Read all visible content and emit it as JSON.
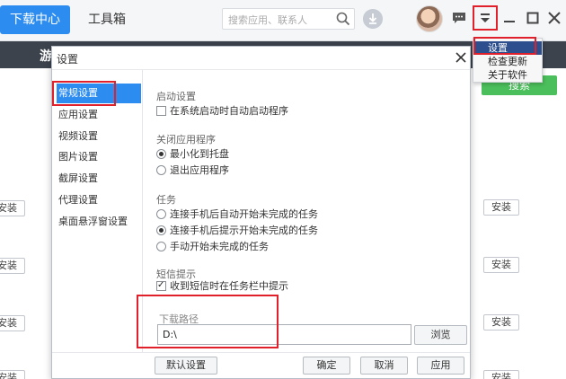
{
  "topbar": {
    "tab_download_center": "下载中心",
    "tab_toolbox": "工具箱",
    "search_placeholder": "搜索应用、联系人"
  },
  "strip": {
    "text": "游"
  },
  "background": {
    "search_button": "搜索",
    "install_label": "安装"
  },
  "dropdown": {
    "items": [
      "设置",
      "检查更新",
      "关于软件"
    ]
  },
  "dialog": {
    "title": "设置",
    "sidebar": [
      "常规设置",
      "应用设置",
      "视频设置",
      "图片设置",
      "截屏设置",
      "代理设置",
      "桌面悬浮窗设置"
    ],
    "startup": {
      "title": "启动设置",
      "option": "在系统启动时自动启动程序"
    },
    "close_app": {
      "title": "关闭应用程序",
      "opt_minimize": "最小化到托盘",
      "opt_exit": "退出应用程序"
    },
    "tasks": {
      "title": "任务",
      "opt_auto": "连接手机后自动开始未完成的任务",
      "opt_prompt": "连接手机后提示开始未完成的任务",
      "opt_manual": "手动开始未完成的任务"
    },
    "sms": {
      "title": "短信提示",
      "option": "收到短信时在任务栏中提示"
    },
    "download_path": {
      "label": "下载路径",
      "value": "D:\\",
      "browse": "浏览"
    },
    "footer": {
      "default": "默认设置",
      "ok": "确定",
      "cancel": "取消",
      "apply": "应用"
    }
  }
}
